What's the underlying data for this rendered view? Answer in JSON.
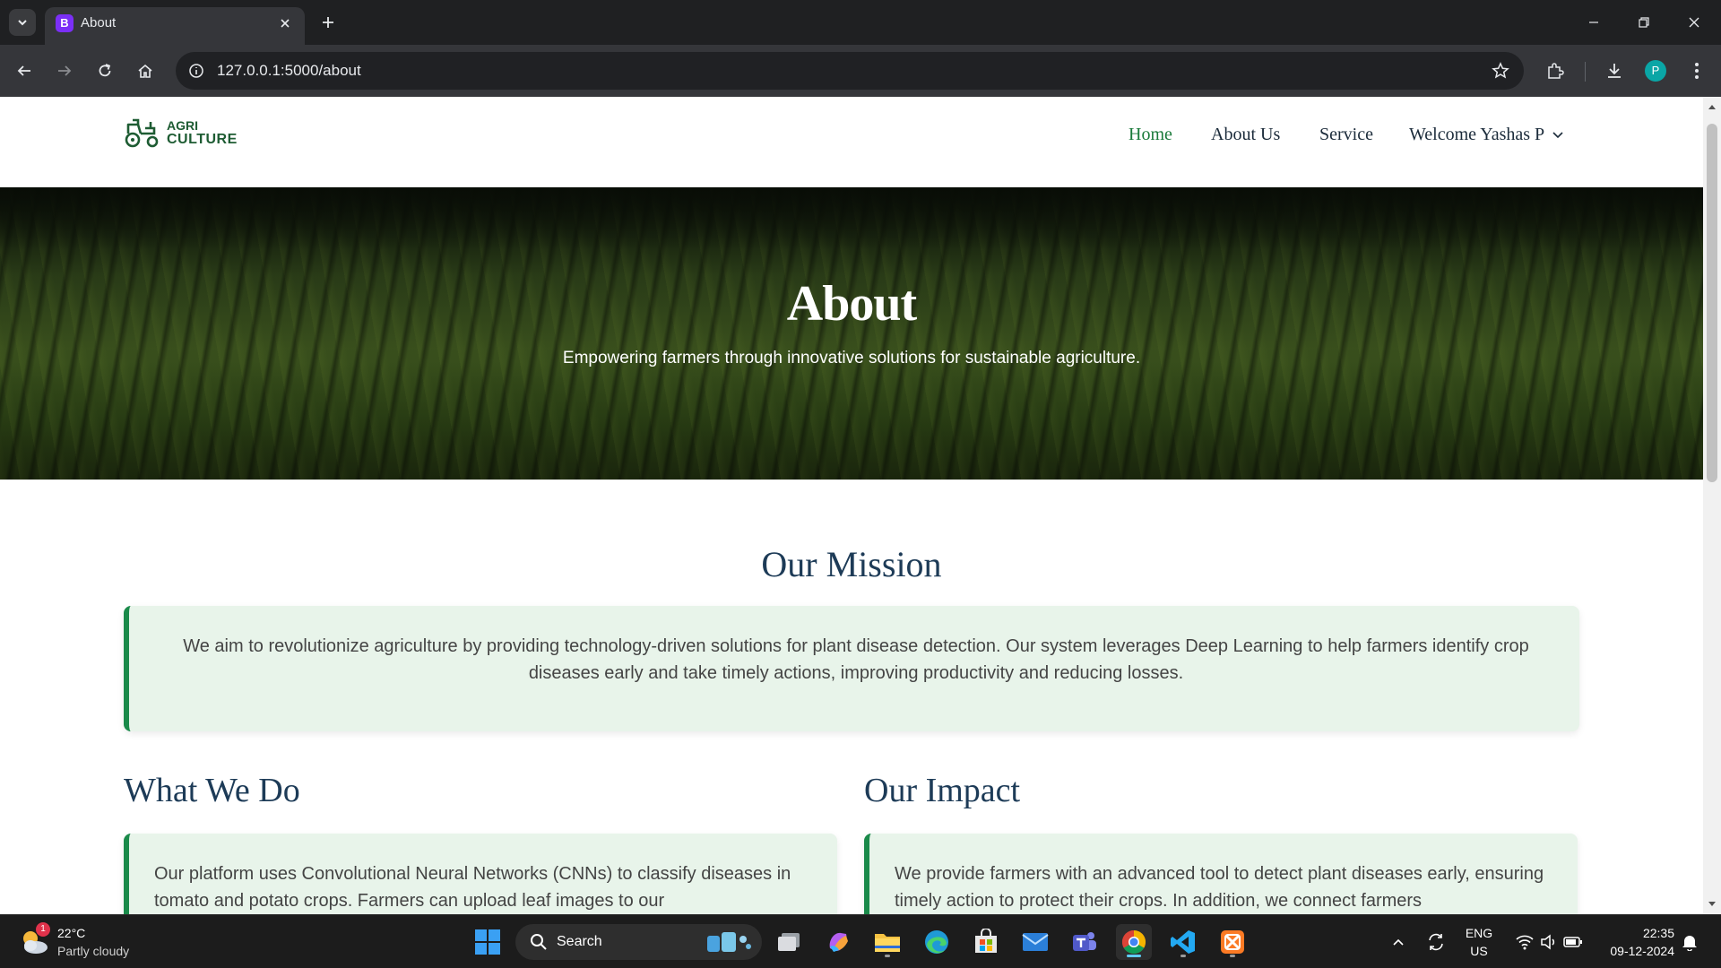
{
  "browser": {
    "tab_title": "About",
    "tab_favicon_letter": "B",
    "url": "127.0.0.1:5000/about",
    "profile_initial": "P"
  },
  "site": {
    "logo": {
      "line1": "AGRI",
      "line2": "CULTURE",
      "icon": "tractor-icon"
    },
    "nav": [
      {
        "label": "Home",
        "active": true
      },
      {
        "label": "About Us"
      },
      {
        "label": "Service"
      },
      {
        "label": "Welcome Yashas P",
        "dropdown": true
      }
    ],
    "hero": {
      "title": "About",
      "subtitle": "Empowering farmers through innovative solutions for sustainable agriculture."
    },
    "mission": {
      "title": "Our Mission",
      "text": "We aim to revolutionize agriculture by providing technology-driven solutions for plant disease detection. Our system leverages Deep Learning to help farmers identify crop diseases early and take timely actions, improving productivity and reducing losses."
    },
    "what_we_do": {
      "title": "What We Do",
      "text": "Our platform uses Convolutional Neural Networks (CNNs) to classify diseases in tomato and potato crops. Farmers can upload leaf images to our"
    },
    "impact": {
      "title": "Our Impact",
      "text": "We provide farmers with an advanced tool to detect plant diseases early, ensuring timely action to protect their crops. In addition, we connect farmers"
    },
    "accent_color": "#1a8a4a",
    "card_bg": "#e8f4ea"
  },
  "taskbar": {
    "weather_temp": "22°C",
    "weather_desc": "Partly cloudy",
    "weather_badge": "1",
    "search_label": "Search",
    "lang_line1": "ENG",
    "lang_line2": "US",
    "time": "22:35",
    "date": "09-12-2024"
  }
}
